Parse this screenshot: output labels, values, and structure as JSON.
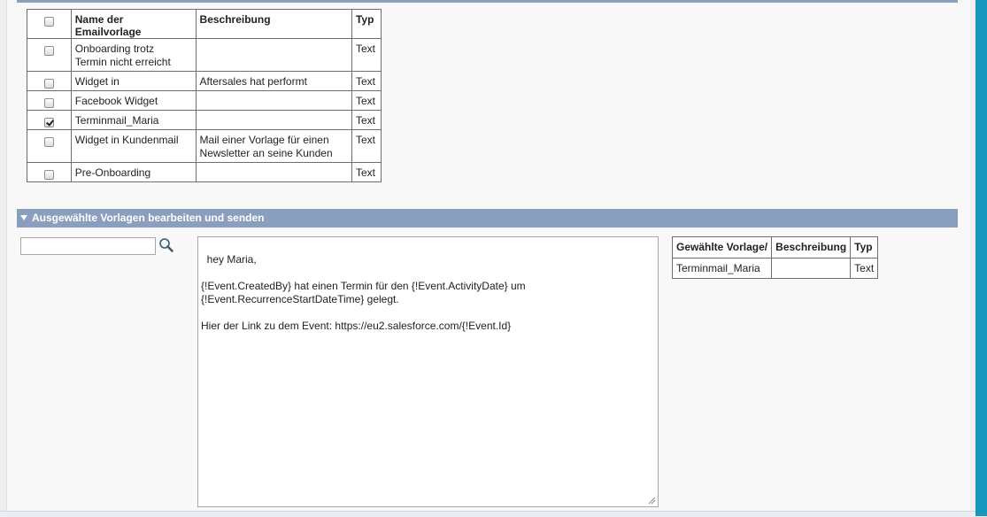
{
  "templates_table": {
    "headers": {
      "name": "Name der Emailvorlage",
      "description": "Beschreibung",
      "type": "Typ"
    },
    "rows": [
      {
        "name": "Onboarding trotz\nTermin nicht erreicht",
        "description": "",
        "type": "Text",
        "checked": false
      },
      {
        "name": "Widget in",
        "description": "Aftersales hat performt",
        "type": "Text",
        "checked": false
      },
      {
        "name": "Facebook Widget",
        "description": "",
        "type": "Text",
        "checked": false
      },
      {
        "name": "Terminmail_Maria",
        "description": "",
        "type": "Text",
        "checked": true
      },
      {
        "name": "Widget in Kundenmail",
        "description": "Mail einer Vorlage für einen\nNewsletter an seine Kunden",
        "type": "Text",
        "checked": false
      },
      {
        "name": "Pre-Onboarding",
        "description": "",
        "type": "Text",
        "checked": false
      }
    ]
  },
  "edit_section": {
    "title": "Ausgewählte Vorlagen bearbeiten und senden",
    "search": {
      "value": "",
      "placeholder": ""
    },
    "message_body": "hey Maria,\n\n{!Event.CreatedBy} hat einen Termin für den {!Event.ActivityDate} um\n{!Event.RecurrenceStartDateTime} gelegt.\n\nHier der Link zu dem Event: https://eu2.salesforce.com/{!Event.Id}"
  },
  "selected_table": {
    "headers": {
      "name": "Gewählte Vorlage/",
      "description": "Beschreibung",
      "type": "Typ"
    },
    "rows": [
      {
        "name": "Terminmail_Maria",
        "description": "",
        "type": "Text"
      }
    ]
  },
  "icons": {
    "search": "magnifier-icon",
    "resize": "resize-grip-icon",
    "collapse": "triangle-down-icon"
  },
  "colors": {
    "section_header": "#8a9ebe",
    "right_strip": "#1797c0",
    "border": "#6e6e6e"
  }
}
